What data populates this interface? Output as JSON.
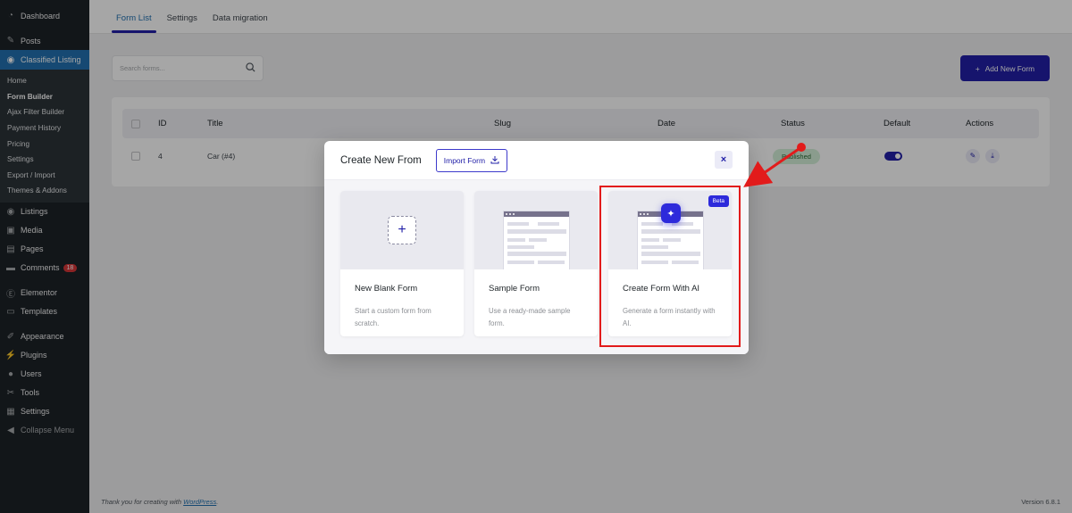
{
  "sidebar": {
    "items": [
      {
        "label": "Dashboard",
        "icon": "dashboard-icon"
      },
      {
        "label": "Posts",
        "icon": "pin-icon"
      },
      {
        "label": "Classified Listing",
        "icon": "location-pin-icon"
      },
      {
        "label": "Listings",
        "icon": "location-pin-icon"
      },
      {
        "label": "Media",
        "icon": "media-icon"
      },
      {
        "label": "Pages",
        "icon": "page-icon"
      },
      {
        "label": "Comments",
        "icon": "comment-icon",
        "badge": "18"
      },
      {
        "label": "Elementor",
        "icon": "elementor-icon"
      },
      {
        "label": "Templates",
        "icon": "folder-icon"
      },
      {
        "label": "Appearance",
        "icon": "brush-icon"
      },
      {
        "label": "Plugins",
        "icon": "plug-icon"
      },
      {
        "label": "Users",
        "icon": "user-icon"
      },
      {
        "label": "Tools",
        "icon": "wrench-icon"
      },
      {
        "label": "Settings",
        "icon": "settings-icon"
      },
      {
        "label": "Collapse Menu",
        "icon": "collapse-icon"
      }
    ],
    "submenu": [
      "Home",
      "Form Builder",
      "Ajax Filter Builder",
      "Payment History",
      "Pricing",
      "Settings",
      "Export / Import",
      "Themes & Addons"
    ]
  },
  "tabs": [
    "Form List",
    "Settings",
    "Data migration"
  ],
  "search": {
    "placeholder": "Search forms..."
  },
  "add_button": {
    "label": "Add New Form",
    "icon": "plus-icon"
  },
  "table": {
    "headers": [
      "ID",
      "Title",
      "Slug",
      "Date",
      "Status",
      "Default",
      "Actions"
    ],
    "rows": [
      {
        "id": "4",
        "title": "Car (#4)",
        "status": "Published"
      }
    ]
  },
  "modal": {
    "title": "Create New From",
    "import_label": "Import Form",
    "close_label": "×",
    "cards": [
      {
        "title": "New Blank Form",
        "desc": "Start a custom form from scratch."
      },
      {
        "title": "Sample Form",
        "desc": "Use a ready-made sample form."
      },
      {
        "title": "Create Form With AI",
        "desc": "Generate a form instantly with AI.",
        "badge": "Beta"
      }
    ]
  },
  "footer": {
    "text": "Thank you for creating with ",
    "link": "WordPress",
    "suffix": ".",
    "version": "Version 6.8.1"
  },
  "colors": {
    "accent": "#2220a8",
    "wp_blue": "#2271b1",
    "sidebar": "#1d2327",
    "annotation": "#e21b1b"
  }
}
